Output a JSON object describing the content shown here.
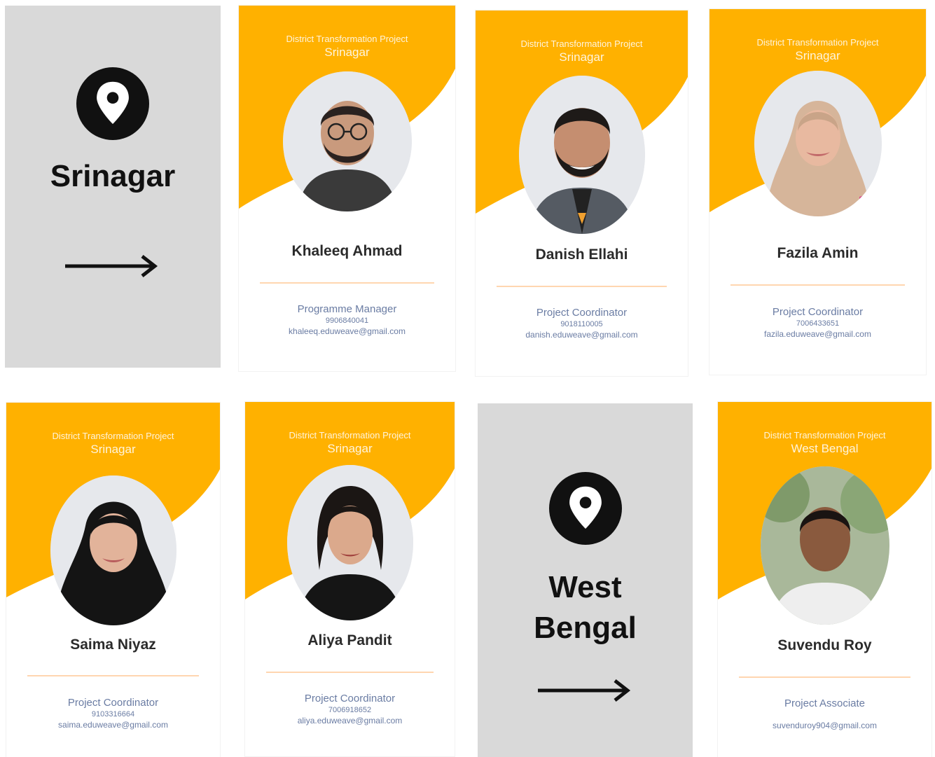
{
  "colors": {
    "accent": "#ffb100",
    "panel": "#d9d9d9",
    "text_dark": "#2b2b2b",
    "text_muted": "#6a7ca3",
    "divider": "#ffd6b0"
  },
  "panels": [
    {
      "location": "Srinagar",
      "icon": "location-pin-icon",
      "arrow": "right-arrow-icon"
    },
    {
      "location": "West Bengal",
      "icon": "location-pin-icon",
      "arrow": "right-arrow-icon"
    }
  ],
  "cards": [
    {
      "project": "District Transformation Project",
      "location": "Srinagar",
      "name": "Khaleeq Ahmad",
      "role": "Programme Manager",
      "phone": "9906840041",
      "email": "khaleeq.eduweave@gmail.com"
    },
    {
      "project": "District Transformation Project",
      "location": "Srinagar",
      "name": "Danish Ellahi",
      "role": "Project Coordinator",
      "phone": "9018110005",
      "email": "danish.eduweave@gmail.com"
    },
    {
      "project": "District Transformation Project",
      "location": "Srinagar",
      "name": "Fazila Amin",
      "role": "Project Coordinator",
      "phone": "7006433651",
      "email": "fazila.eduweave@gmail.com"
    },
    {
      "project": "District Transformation Project",
      "location": "Srinagar",
      "name": "Saima Niyaz",
      "role": "Project Coordinator",
      "phone": "9103316664",
      "email": "saima.eduweave@gmail.com"
    },
    {
      "project": "District Transformation Project",
      "location": "Srinagar",
      "name": "Aliya Pandit",
      "role": "Project Coordinator",
      "phone": "7006918652",
      "email": "aliya.eduweave@gmail.com"
    },
    {
      "project": "District Transformation Project",
      "location": "West Bengal",
      "name": "Suvendu Roy",
      "role": "Project Associate",
      "phone": "",
      "email": "suvenduroy904@gmail.com"
    }
  ]
}
